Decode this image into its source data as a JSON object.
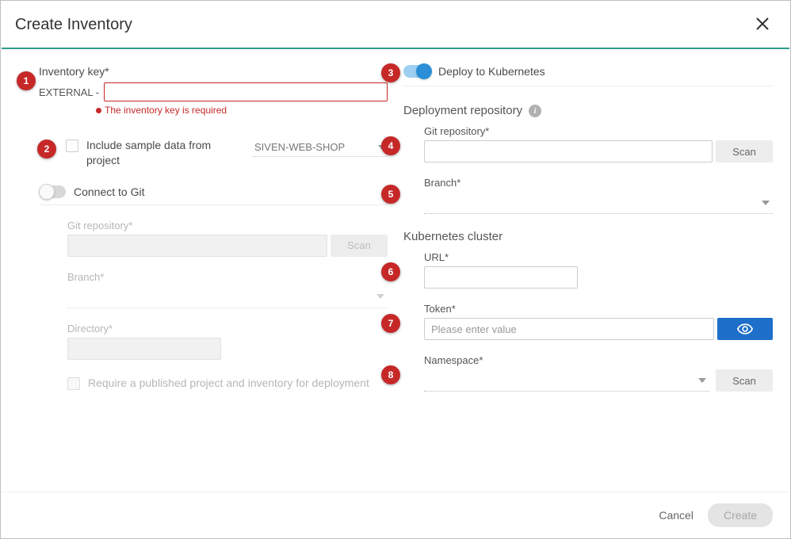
{
  "header": {
    "title": "Create Inventory"
  },
  "left": {
    "invKeyLabel": "Inventory key*",
    "invKeyPrefix": "EXTERNAL -",
    "invKeyError": "The inventory key is required",
    "includeSampleLabel": "Include sample data from project",
    "sampleProject": "SIVEN-WEB-SHOP",
    "connectGitLabel": "Connect to Git",
    "git": {
      "repoLabel": "Git repository*",
      "scan": "Scan",
      "branchLabel": "Branch*",
      "dirLabel": "Directory*",
      "requireLabel": "Require a published project and inventory for deployment"
    }
  },
  "right": {
    "deployLabel": "Deploy to Kubernetes",
    "deployRepoHead": "Deployment repository",
    "repoLabel": "Git repository*",
    "scan": "Scan",
    "branchLabel": "Branch*",
    "k8sHead": "Kubernetes cluster",
    "urlLabel": "URL*",
    "tokenLabel": "Token*",
    "tokenPlaceholder": "Please enter value",
    "nsLabel": "Namespace*"
  },
  "footer": {
    "cancel": "Cancel",
    "create": "Create"
  },
  "badges": {
    "b1": "1",
    "b2": "2",
    "b3": "3",
    "b4": "4",
    "b5": "5",
    "b6": "6",
    "b7": "7",
    "b8": "8"
  }
}
